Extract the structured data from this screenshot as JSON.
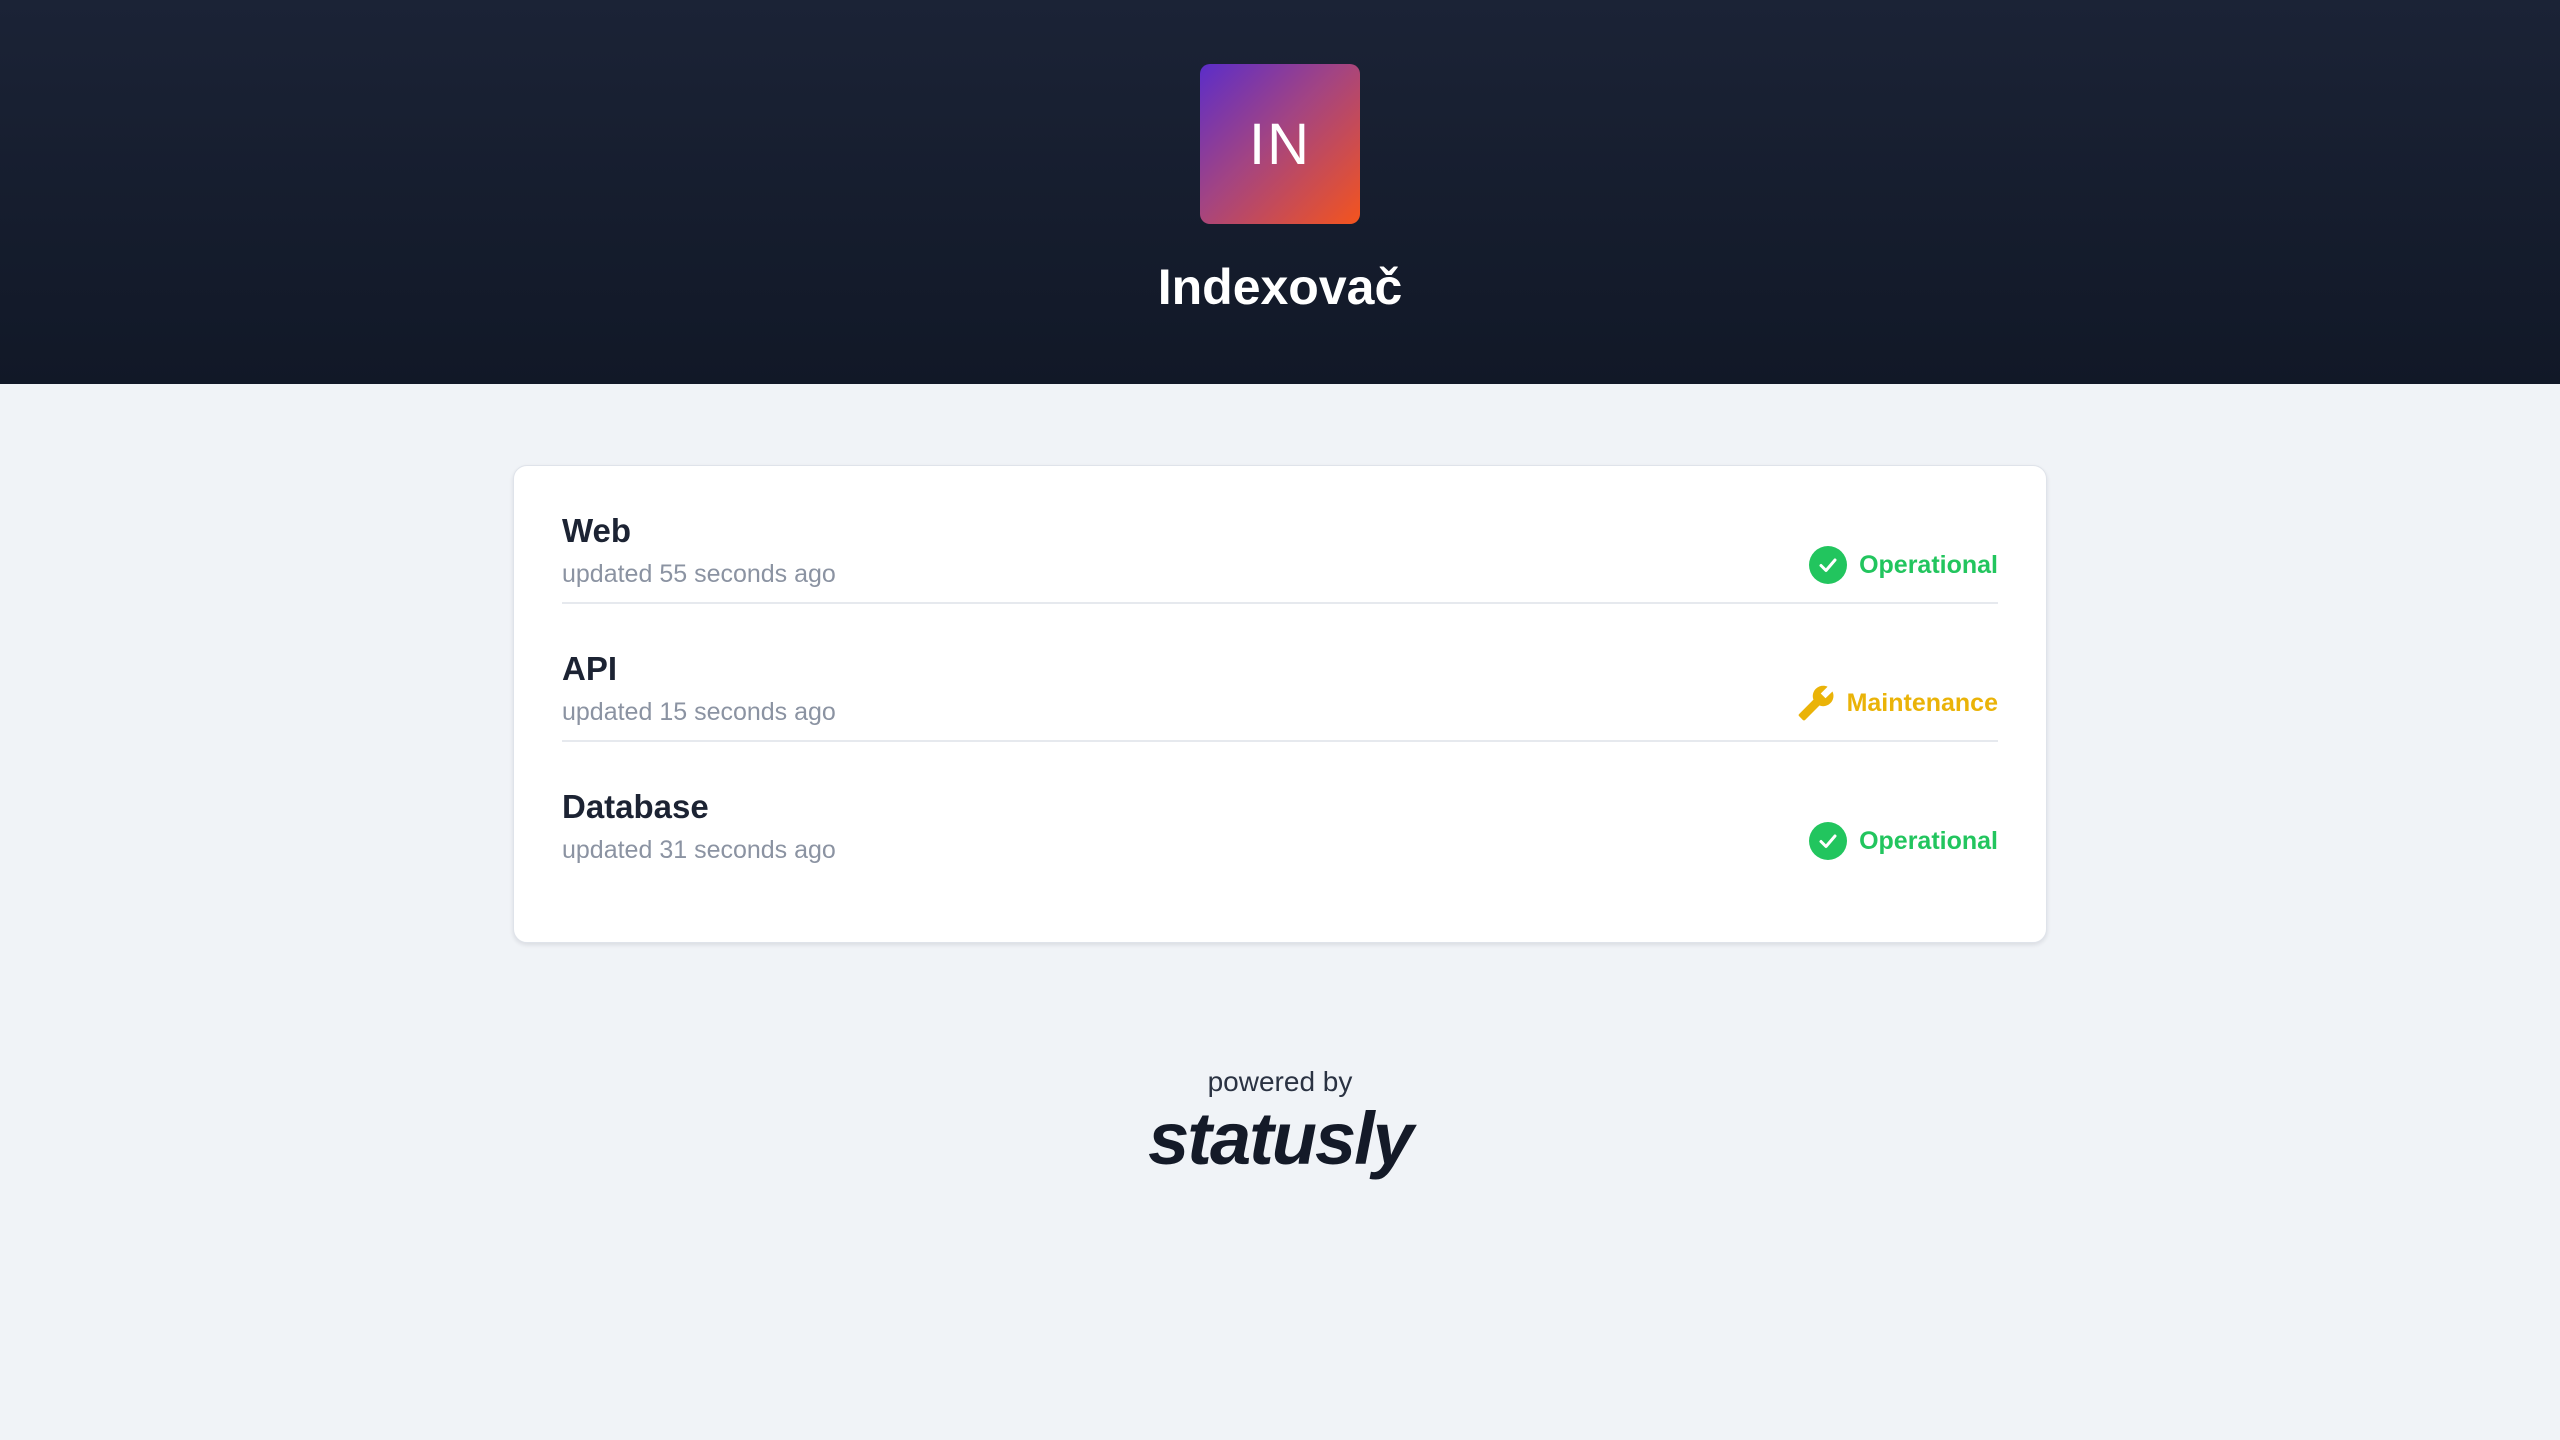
{
  "header": {
    "logo_initials": "IN",
    "title": "Indexovač",
    "logo_gradient": [
      "#5b2dc9",
      "#f4541d"
    ]
  },
  "services": [
    {
      "name": "Web",
      "updated": "updated 55 seconds ago",
      "status": "Operational",
      "status_icon": "check-circle-icon",
      "status_color": "#22c55e"
    },
    {
      "name": "API",
      "updated": "updated 15 seconds ago",
      "status": "Maintenance",
      "status_icon": "wrench-icon",
      "status_color": "#eab308"
    },
    {
      "name": "Database",
      "updated": "updated 31 seconds ago",
      "status": "Operational",
      "status_icon": "check-circle-icon",
      "status_color": "#22c55e"
    }
  ],
  "footer": {
    "powered_by": "powered by",
    "brand": "statusly"
  }
}
